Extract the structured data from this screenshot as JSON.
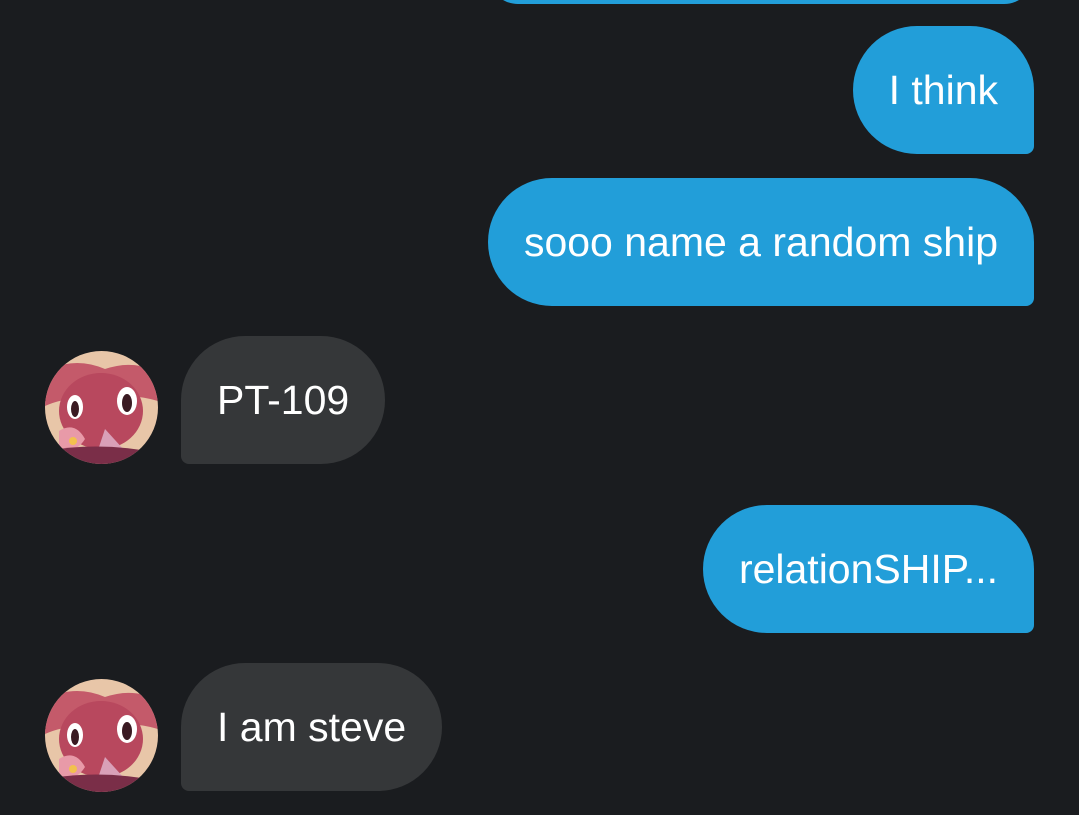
{
  "conversation": {
    "messages": [
      {
        "direction": "outgoing",
        "text": "I think"
      },
      {
        "direction": "outgoing",
        "text": "sooo name a random ship"
      },
      {
        "direction": "incoming",
        "text": "PT-109"
      },
      {
        "direction": "outgoing",
        "text": "relationSHIP..."
      },
      {
        "direction": "incoming",
        "text": "I am steve"
      }
    ]
  },
  "colors": {
    "background": "#1a1c1f",
    "outgoing_bubble": "#229ed9",
    "incoming_bubble": "#353739",
    "text": "#ffffff"
  },
  "icons": {
    "avatar": "contact-avatar-icon"
  }
}
